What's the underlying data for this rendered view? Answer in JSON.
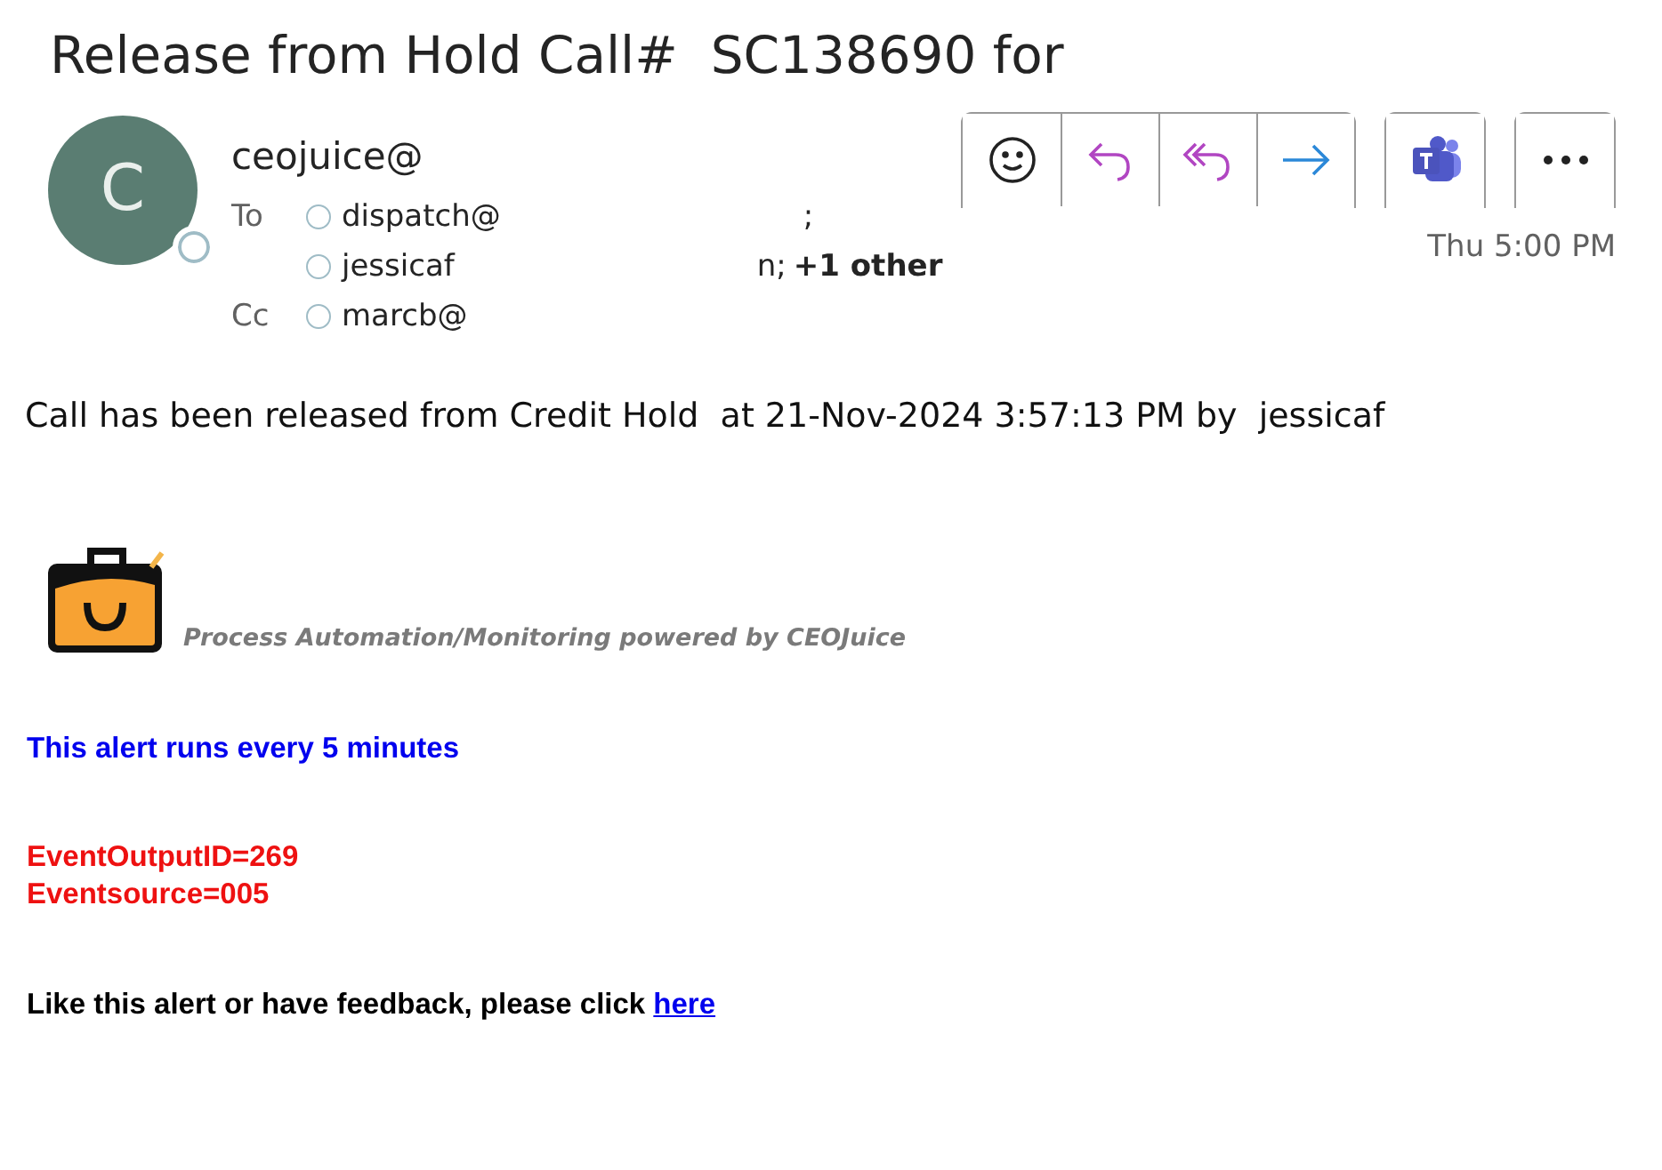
{
  "subject": "Release from Hold Call#  SC138690 for",
  "sender": {
    "initial": "C",
    "name": "ceojuice@"
  },
  "actions": [
    {
      "kind": "emoji"
    },
    {
      "kind": "reply"
    },
    {
      "kind": "reply-all"
    },
    {
      "kind": "forward"
    },
    {
      "kind": "teams"
    },
    {
      "kind": "more"
    }
  ],
  "time": "Thu 5:00 PM",
  "recipients": [
    {
      "label": "To",
      "name": "dispatch@",
      "tail": ";"
    },
    {
      "name": "jessicaf",
      "tail": "n;",
      "extra": "+1 other"
    },
    {
      "label": "Cc",
      "name": "marcb@"
    }
  ],
  "message": "Call has been released from Credit Hold  at 21-Nov-2024 3:57:13 PM by  jessicaf",
  "caption": "Process Automation/Monitoring powered by CEOJuice",
  "schedule": "This alert runs every 5 minutes",
  "event_lines": [
    "EventOutputID=269",
    "Eventsource=005"
  ],
  "feedback": {
    "text": "Like this alert or have feedback, please click",
    "link": "here"
  }
}
